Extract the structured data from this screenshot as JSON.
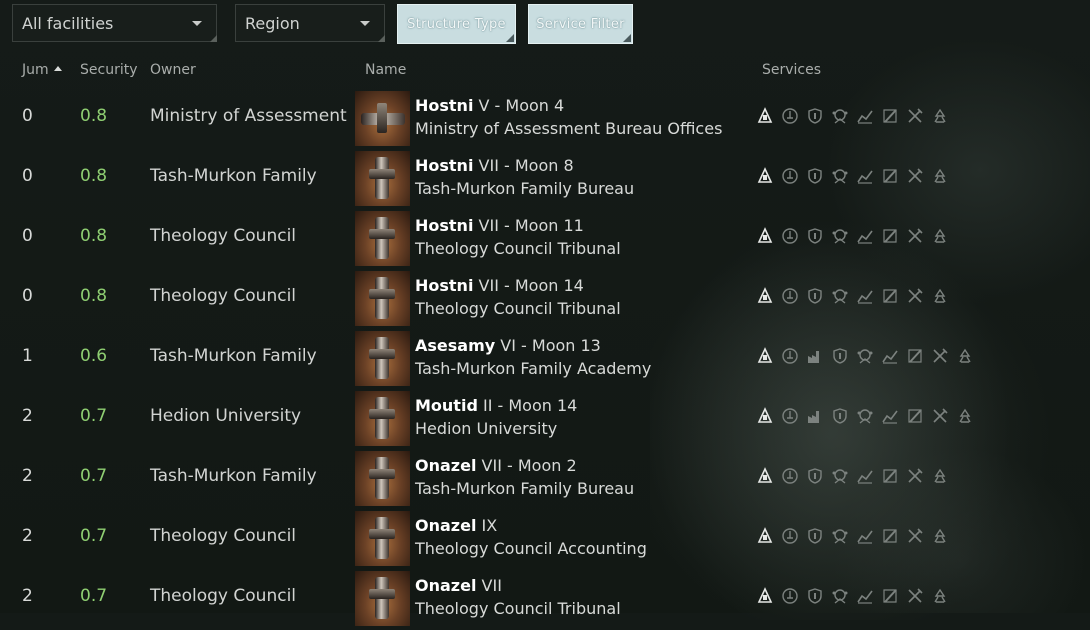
{
  "filters": {
    "facilities": "All facilities",
    "region": "Region",
    "structure_type": "Structure Type",
    "service_filter": "Service Filter"
  },
  "columns": {
    "jumps": "Jum",
    "security": "Security",
    "owner": "Owner",
    "name": "Name",
    "services": "Services"
  },
  "rows": [
    {
      "jumps": "0",
      "security": "0.8",
      "owner": "Ministry of Assessment",
      "system": "Hostni",
      "location": " V - Moon 4",
      "station": "Ministry of Assessment Bureau Offices"
    },
    {
      "jumps": "0",
      "security": "0.8",
      "owner": "Tash-Murkon Family",
      "system": "Hostni",
      "location": " VII - Moon 8",
      "station": "Tash-Murkon Family Bureau"
    },
    {
      "jumps": "0",
      "security": "0.8",
      "owner": "Theology Council",
      "system": "Hostni",
      "location": " VII - Moon 11",
      "station": "Theology Council Tribunal"
    },
    {
      "jumps": "0",
      "security": "0.8",
      "owner": "Theology Council",
      "system": "Hostni",
      "location": " VII - Moon 14",
      "station": "Theology Council Tribunal"
    },
    {
      "jumps": "1",
      "security": "0.6",
      "owner": "Tash-Murkon Family",
      "system": "Asesamy",
      "location": " VI - Moon 13",
      "station": "Tash-Murkon Family Academy"
    },
    {
      "jumps": "2",
      "security": "0.7",
      "owner": "Hedion University",
      "system": "Moutid",
      "location": " II - Moon 14",
      "station": "Hedion University"
    },
    {
      "jumps": "2",
      "security": "0.7",
      "owner": "Tash-Murkon Family",
      "system": "Onazel",
      "location": " VII - Moon 2",
      "station": "Tash-Murkon Family Bureau"
    },
    {
      "jumps": "2",
      "security": "0.7",
      "owner": "Theology Council",
      "system": "Onazel",
      "location": " IX",
      "station": "Theology Council Accounting"
    },
    {
      "jumps": "2",
      "security": "0.7",
      "owner": "Theology Council",
      "system": "Onazel",
      "location": " VII",
      "station": "Theology Council Tribunal"
    }
  ],
  "service_icons_8": [
    "clone-bay-icon",
    "insurance-icon",
    "security-office-icon",
    "lp-store-icon",
    "market-icon",
    "repair-shop-icon",
    "fitting-icon",
    "reprocessing-icon"
  ],
  "service_icons_9": [
    "clone-bay-icon",
    "insurance-icon",
    "factory-icon",
    "security-office-icon",
    "lp-store-icon",
    "market-icon",
    "repair-shop-icon",
    "fitting-icon",
    "reprocessing-icon"
  ],
  "colors": {
    "security_green": "#8fcf72",
    "filter_button_bg": "#c9dde0"
  }
}
